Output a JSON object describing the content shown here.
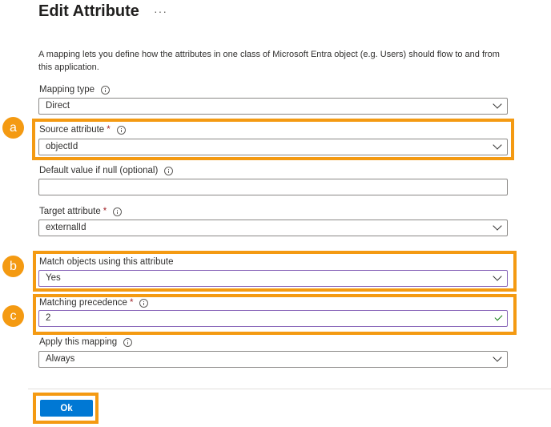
{
  "header": {
    "title": "Edit Attribute",
    "more": "···"
  },
  "description": "A mapping lets you define how the attributes in one class of Microsoft Entra object (e.g. Users) should flow to and from this application.",
  "fields": {
    "mapping_type": {
      "label": "Mapping type",
      "value": "Direct"
    },
    "source_attribute": {
      "label": "Source attribute",
      "required": "*",
      "value": "objectId"
    },
    "default_value": {
      "label": "Default value if null (optional)",
      "value": ""
    },
    "target_attribute": {
      "label": "Target attribute",
      "required": "*",
      "value": "externalId"
    },
    "match_objects": {
      "label": "Match objects using this attribute",
      "value": "Yes"
    },
    "matching_precedence": {
      "label": "Matching precedence",
      "required": "*",
      "value": "2"
    },
    "apply_mapping": {
      "label": "Apply this mapping",
      "value": "Always"
    }
  },
  "callouts": {
    "a": "a",
    "b": "b",
    "c": "c"
  },
  "actions": {
    "ok_label": "Ok"
  },
  "colors": {
    "accent": "#0078d4",
    "callout": "#f49a12",
    "required": "#a4262c",
    "valid": "#107c10"
  }
}
